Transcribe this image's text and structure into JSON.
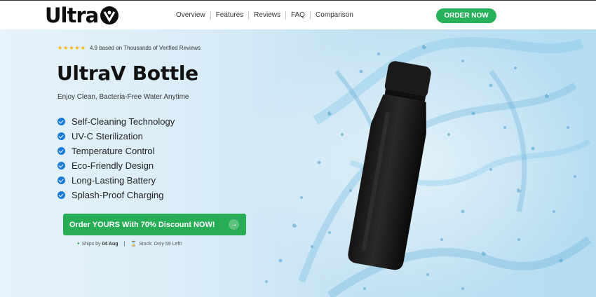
{
  "header": {
    "logo_text": "Ultra",
    "logo_mark_icon": "v-shield-logo",
    "nav": [
      "Overview",
      "Features",
      "Reviews",
      "FAQ",
      "Comparison"
    ],
    "order_button": "ORDER NOW"
  },
  "hero": {
    "stars": "★★★★★",
    "rating_text": "4.9 based on Thousands of Verified Reviews",
    "title": "UltraV Bottle",
    "subtitle": "Enjoy Clean, Bacteria-Free Water Anytime",
    "features": [
      "Self-Cleaning Technology",
      "UV-C Sterilization",
      "Temperature Control",
      "Eco-Friendly Design",
      "Long-Lasting Battery",
      "Splash-Proof Charging"
    ],
    "cta_label": "Order YOURS With 70% Discount NOW!",
    "cta_arrow": "→",
    "ship_prefix": "Ships by",
    "ship_date": "04 Aug",
    "separator": "|",
    "stock_text": "Stock: Only 59 Left!"
  },
  "colors": {
    "accent_green": "#27ad55",
    "check_blue": "#1a7ad8",
    "star_gold": "#f5b301"
  }
}
